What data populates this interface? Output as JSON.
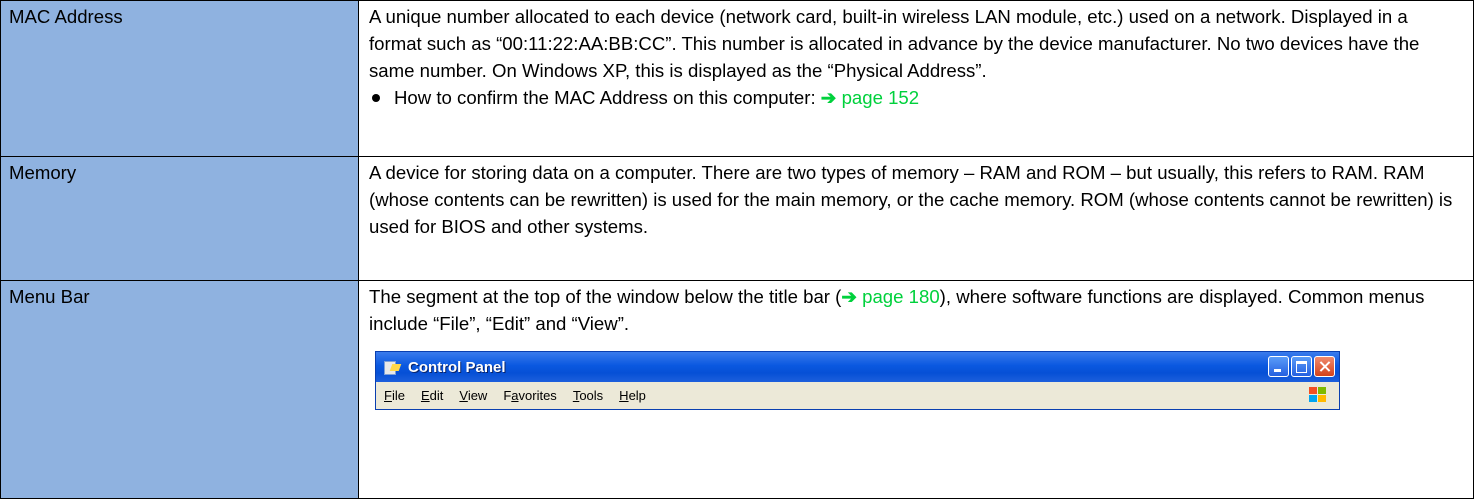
{
  "rows": [
    {
      "term": "MAC Address",
      "definition": "A unique number allocated to each device (network card, built-in wireless LAN module, etc.) used on a network. Displayed in a format such as “00:11:22:AA:BB:CC”. This number is allocated in advance by the device manufacturer.  No two devices have the same number.  On Windows XP, this is displayed as the “Physical Address”.",
      "bullet_text": "How to confirm the MAC Address on this computer: ",
      "bullet_link": "page 152"
    },
    {
      "term": "Memory",
      "definition": "A device for storing data on a computer.  There are two types of memory – RAM and ROM – but usually, this refers to RAM. RAM (whose contents can be rewritten) is used for the main memory, or the cache memory.  ROM (whose contents cannot be rewritten) is used for BIOS and other systems."
    },
    {
      "term": "Menu Bar",
      "definition_before": "The segment at the top of the window below the title bar (",
      "definition_link": "page 180",
      "definition_after": "), where software functions are displayed.  Common menus include “File”, “Edit” and “View”."
    }
  ],
  "arrow_glyph": "➔",
  "screenshot": {
    "window_title": "Control Panel",
    "menu_items": [
      "File",
      "Edit",
      "View",
      "Favorites",
      "Tools",
      "Help"
    ],
    "mnemonics": [
      "F",
      "E",
      "V",
      "a",
      "T",
      "H"
    ]
  },
  "colors": {
    "term_background": "#8fb2e0",
    "link": "#00d13c",
    "xp_titlebar": "#0a58e0"
  }
}
